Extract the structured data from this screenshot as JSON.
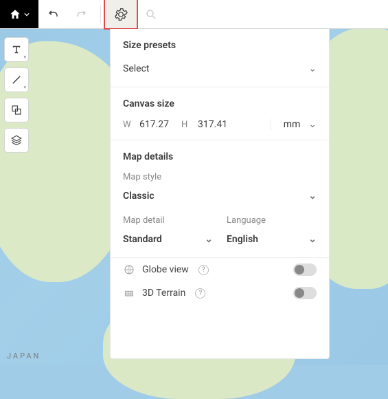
{
  "panel": {
    "size_presets_head": "Size presets",
    "size_presets_value": "Select",
    "canvas_size_head": "Canvas size",
    "w_label": "W",
    "w_value": "617.27",
    "h_label": "H",
    "h_value": "317.41",
    "unit": "mm",
    "map_details_head": "Map details",
    "map_style_label": "Map style",
    "map_style_value": "Classic",
    "map_detail_label": "Map detail",
    "map_detail_value": "Standard",
    "language_label": "Language",
    "language_value": "English",
    "globe_view": "Globe view",
    "terrain_3d": "3D Terrain"
  },
  "map": {
    "country_label": "JAPAN"
  }
}
